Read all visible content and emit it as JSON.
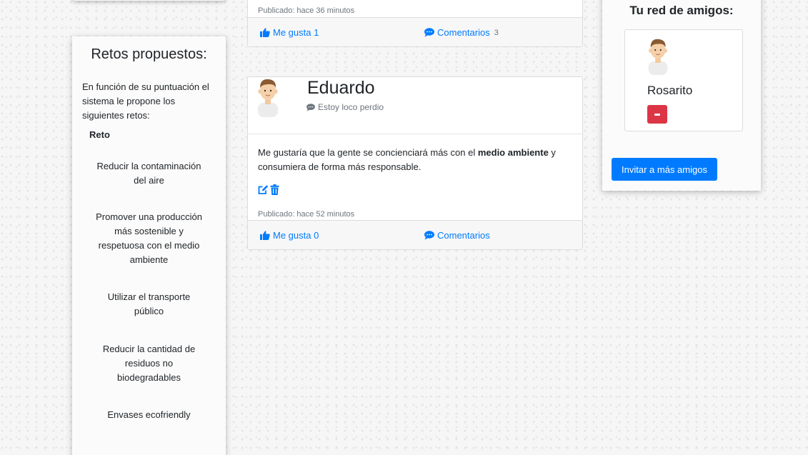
{
  "challenges_panel": {
    "title": "Retos propuestos:",
    "intro": "En función de su puntuación el sistema le propone los siguientes retos:",
    "column_header": "Reto",
    "items": [
      "Reducir la contaminación del aire",
      "Promover una producción más sostenible y respetuosa con el medio ambiente",
      "Utilizar el transporte público",
      "Reducir la cantidad de residuos no biodegradables",
      "Envases ecofriendly"
    ]
  },
  "posts": [
    {
      "published": "Publicado: hace 36 minutos",
      "like_label": "Me gusta 1",
      "comments_label": "Comentarios",
      "comments_count": "3"
    },
    {
      "author": "Eduardo",
      "status": "Estoy loco perdio",
      "body_before": "Me gustaría que la gente se concienciará más con el ",
      "body_bold": "medio ambiente",
      "body_after": " y consumiera de forma más responsable.",
      "published": "Publicado: hace 52 minutos",
      "like_label": "Me gusta 0",
      "comments_label": "Comentarios"
    }
  ],
  "friends_panel": {
    "title": "Tu red de amigos:",
    "friends": [
      {
        "name": "Rosarito"
      }
    ],
    "invite_label": "Invitar a más amigos"
  },
  "colors": {
    "primary": "#007bff",
    "danger": "#dc3545",
    "muted": "#6c757d"
  }
}
